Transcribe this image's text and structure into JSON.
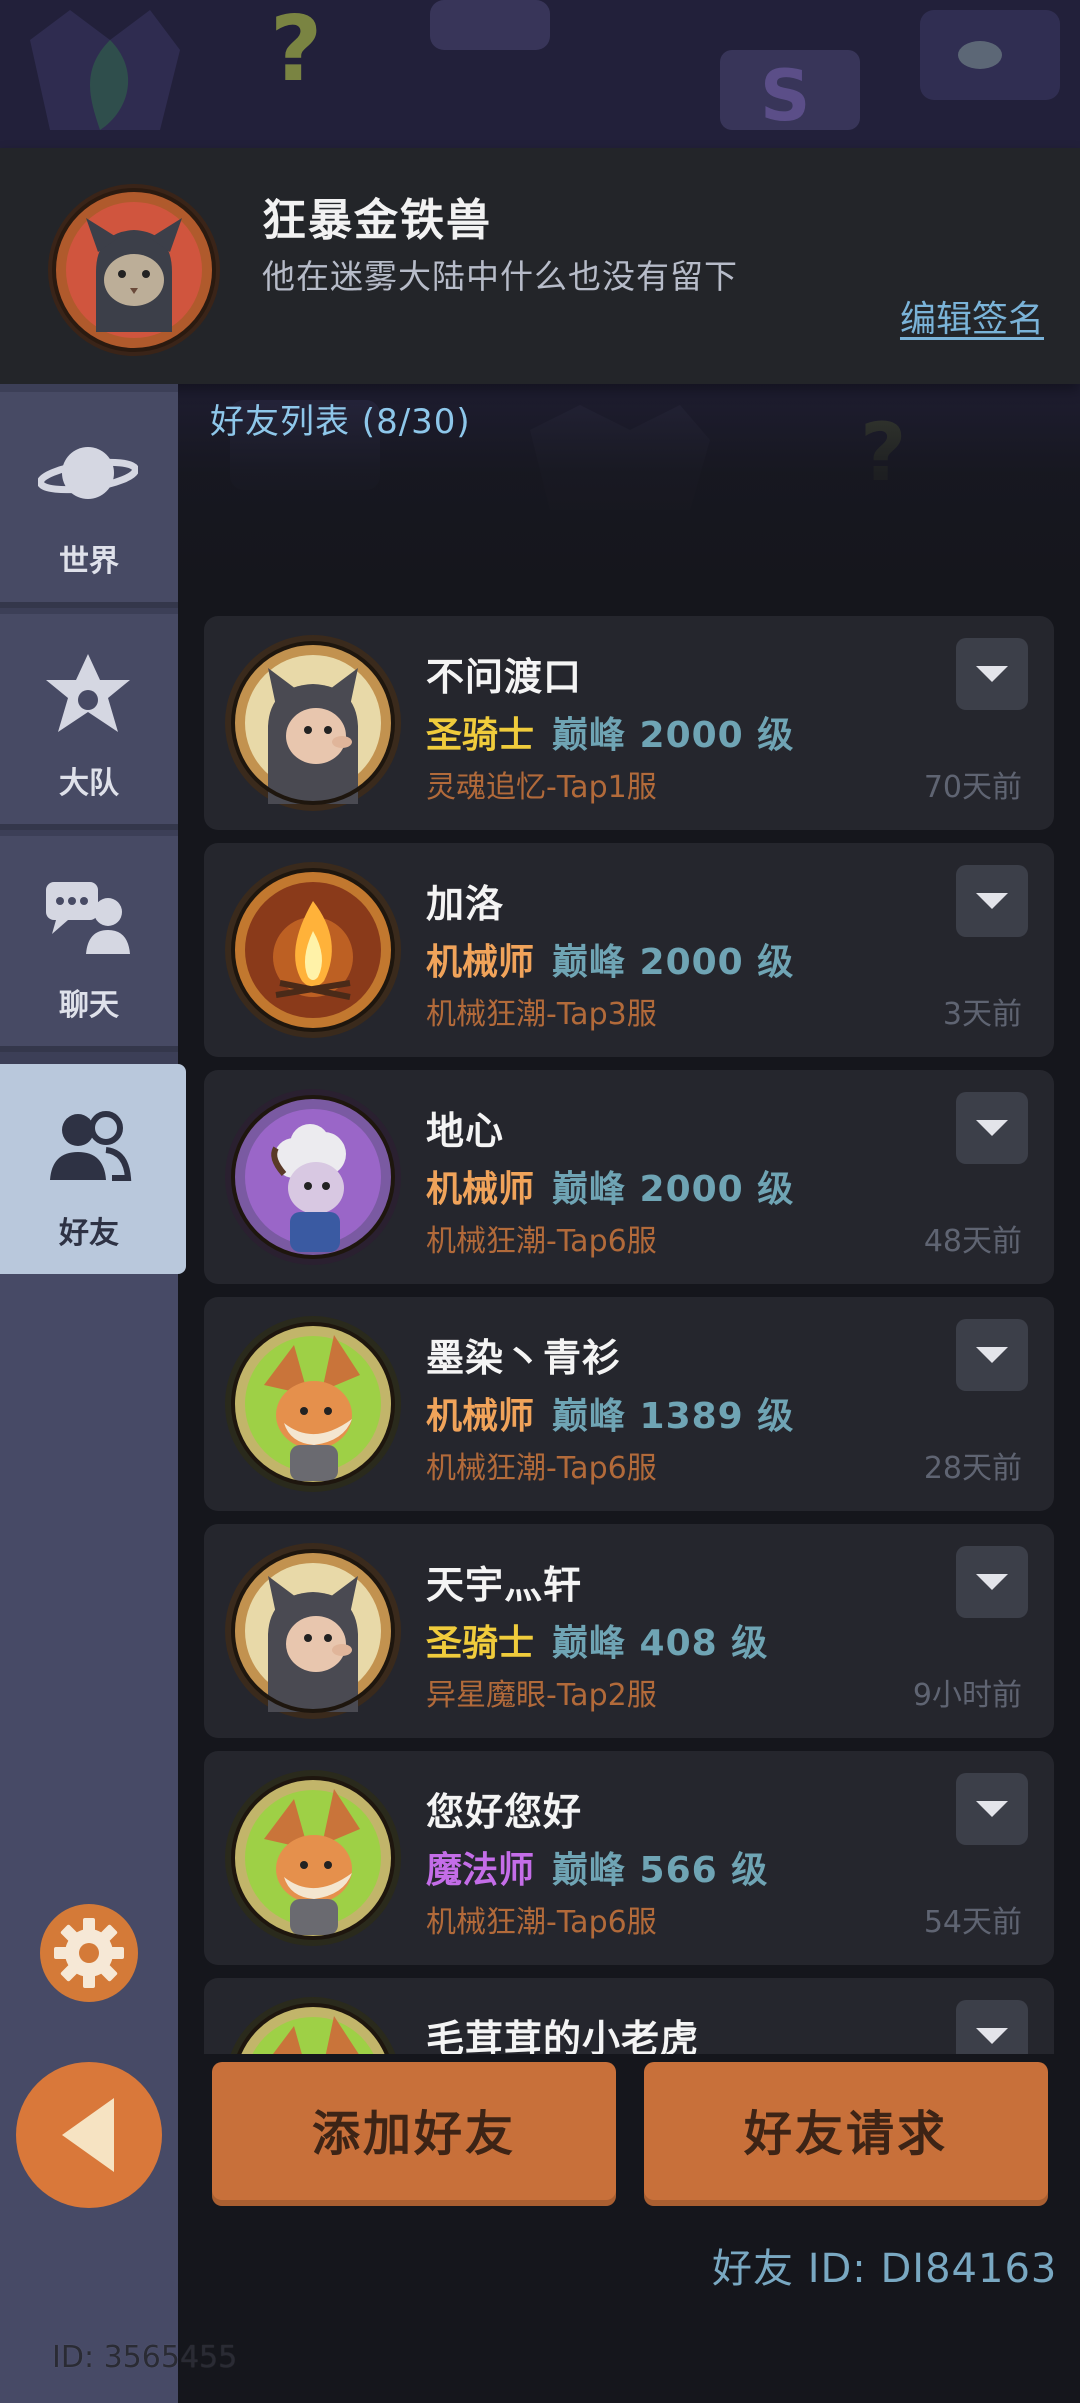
{
  "profile": {
    "name": "狂暴金铁兽",
    "signature": "他在迷雾大陆中什么也没有留下",
    "edit_label": "编辑签名"
  },
  "list": {
    "title": "好友列表 (8/30)"
  },
  "sidebar": {
    "tabs": [
      {
        "label": "世界",
        "icon": "planet-icon"
      },
      {
        "label": "大队",
        "icon": "guild-emblem-icon"
      },
      {
        "label": "聊天",
        "icon": "chat-icon"
      },
      {
        "label": "好友",
        "icon": "friends-icon",
        "active": true
      }
    ]
  },
  "friends": [
    {
      "name": "不问渡口",
      "class": "圣骑士",
      "class_color": "#f0cc3c",
      "level": "巅峰 2000 级",
      "server": "灵魂追忆-Tap1服",
      "time": "70天前",
      "avatar": "cat-hood-avatar"
    },
    {
      "name": "加洛",
      "class": "机械师",
      "class_color": "#f0a35a",
      "level": "巅峰 2000 级",
      "server": "机械狂潮-Tap3服",
      "time": "3天前",
      "avatar": "campfire-avatar"
    },
    {
      "name": "地心",
      "class": "机械师",
      "class_color": "#f0a35a",
      "level": "巅峰 2000 级",
      "server": "机械狂潮-Tap6服",
      "time": "48天前",
      "avatar": "sheep-avatar"
    },
    {
      "name": "墨染丶青衫",
      "class": "机械师",
      "class_color": "#f0a35a",
      "level": "巅峰 1389 级",
      "server": "机械狂潮-Tap6服",
      "time": "28天前",
      "avatar": "fox-avatar"
    },
    {
      "name": "天宇灬轩",
      "class": "圣骑士",
      "class_color": "#f0cc3c",
      "level": "巅峰 408 级",
      "server": "异星魔眼-Tap2服",
      "time": "9小时前",
      "avatar": "cat-hood-avatar"
    },
    {
      "name": "您好您好",
      "class": "魔法师",
      "class_color": "#c46de8",
      "level": "巅峰 566 级",
      "server": "机械狂潮-Tap6服",
      "time": "54天前",
      "avatar": "fox-avatar"
    },
    {
      "name": "毛茸茸的小老虎",
      "class": "",
      "class_color": "#f0a35a",
      "level": "",
      "server": "",
      "time": "",
      "avatar": "fox-avatar"
    }
  ],
  "buttons": {
    "add_friend": "添加好友",
    "friend_request": "好友请求"
  },
  "friend_id": "好友 ID: DI84163",
  "footer_id": "ID: 3565455",
  "colors": {
    "accent": "#c8703a",
    "link": "#7ab3d8",
    "level": "#6fa4b4",
    "server": "#b26a3a"
  }
}
